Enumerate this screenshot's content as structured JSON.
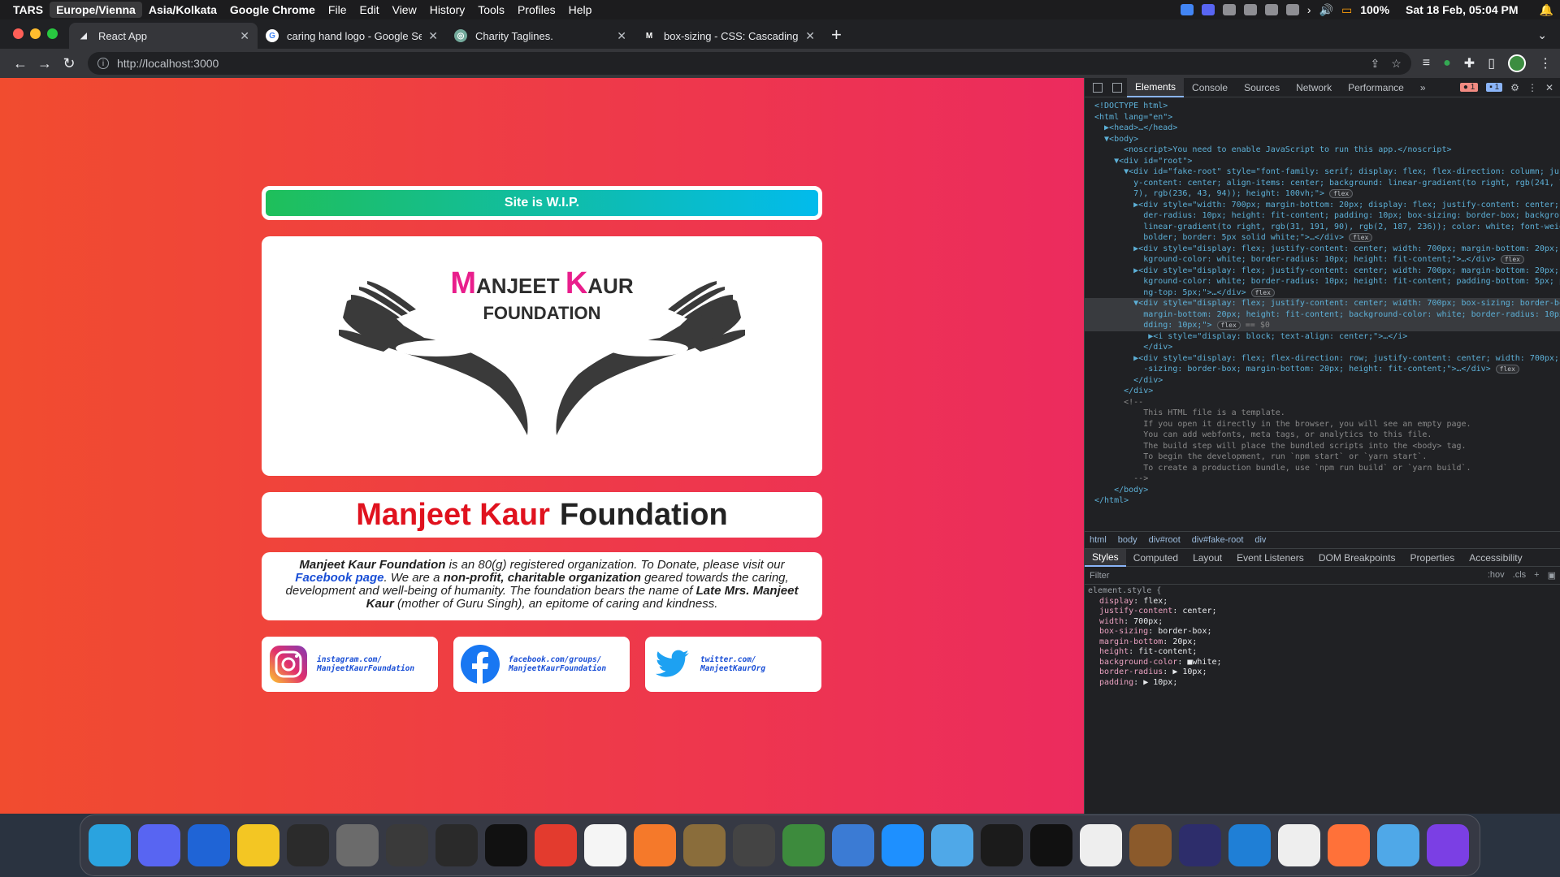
{
  "menubar": {
    "app_prefix": "TARS",
    "timezones": [
      "Europe/Vienna",
      "Asia/Kolkata"
    ],
    "app_name": "Google Chrome",
    "menus": [
      "File",
      "Edit",
      "View",
      "History",
      "Tools",
      "Profiles",
      "Help"
    ],
    "battery": "100%",
    "clock": "Sat 18 Feb, 05:04 PM"
  },
  "tabs": [
    {
      "title": "React App",
      "active": true
    },
    {
      "title": "caring hand logo - Google Sea"
    },
    {
      "title": "Charity Taglines."
    },
    {
      "title": "box-sizing - CSS: Cascading S"
    }
  ],
  "toolbar": {
    "url": "http://localhost:3000"
  },
  "page": {
    "wip": "Site is W.I.P.",
    "logo": {
      "line1_a": "M",
      "line1_b": "ANJEET ",
      "line1_c": "K",
      "line1_d": "AUR",
      "line2": "FOUNDATION"
    },
    "title_red": "Manjeet Kaur",
    "title_dark": "Foundation",
    "desc": {
      "p1": "Manjeet Kaur Foundation",
      "p2": " is an 80(g) registered organization. To Donate, please visit our ",
      "link": "Facebook page",
      "p3": ". We are a ",
      "p4": "non-profit, charitable organization",
      "p5": " geared towards the caring, development and well-being of humanity. The foundation bears the name of ",
      "p6": "Late Mrs. Manjeet Kaur",
      "p7": " (mother of Guru Singh), an epitome of caring and kindness."
    },
    "social": [
      {
        "l1": "instagram.com/",
        "l2": "ManjeetKaurFoundation"
      },
      {
        "l1": "facebook.com/groups/",
        "l2": "ManjeetKaurFoundation"
      },
      {
        "l1": "twitter.com/",
        "l2": "ManjeetKaurOrg"
      }
    ]
  },
  "devtools": {
    "tabs": [
      "Elements",
      "Console",
      "Sources",
      "Network",
      "Performance"
    ],
    "errors": "1",
    "messages": "1",
    "dom": [
      {
        "t": "<!DOCTYPE html>"
      },
      {
        "t": "<html lang=\"en\">"
      },
      {
        "t": "  ▶<head>…</head>"
      },
      {
        "t": "  ▼<body>"
      },
      {
        "t": "      <noscript>You need to enable JavaScript to run this app.</noscript>"
      },
      {
        "t": "    ▼<div id=\"root\">"
      },
      {
        "t": "      ▼<div id=\"fake-root\" style=\"font-family: serif; display: flex; flex-direction: column; justif"
      },
      {
        "t": "        y-content: center; align-items: center; background: linear-gradient(to right, rgb(241, 76, 4"
      },
      {
        "t": "        7), rgb(236, 43, 94)); height: 100vh;\">",
        "pill": "flex"
      },
      {
        "t": "        ▶<div style=\"width: 700px; margin-bottom: 20px; display: flex; justify-content: center; bor"
      },
      {
        "t": "          der-radius: 10px; height: fit-content; padding: 10px; box-sizing: border-box; background:"
      },
      {
        "t": "          linear-gradient(to right, rgb(31, 191, 90), rgb(2, 187, 236)); color: white; font-weight:"
      },
      {
        "t": "          bolder; border: 5px solid white;\">…</div>",
        "pill": "flex"
      },
      {
        "t": "        ▶<div style=\"display: flex; justify-content: center; width: 700px; margin-bottom: 20px; bac"
      },
      {
        "t": "          kground-color: white; border-radius: 10px; height: fit-content;\">…</div>",
        "pill": "flex"
      },
      {
        "t": "        ▶<div style=\"display: flex; justify-content: center; width: 700px; margin-bottom: 20px; bac"
      },
      {
        "t": "          kground-color: white; border-radius: 10px; height: fit-content; padding-bottom: 5px; paddi"
      },
      {
        "t": "          ng-top: 5px;\">…</div>",
        "pill": "flex"
      },
      {
        "t": "        ▼<div style=\"display: flex; justify-content: center; width: 700px; box-sizing: border-box;",
        "sel": true
      },
      {
        "t": "          margin-bottom: 20px; height: fit-content; background-color: white; border-radius: 10px; pa",
        "sel": true
      },
      {
        "t": "          dding: 10px;\">",
        "pill": "flex",
        "eq": "== $0",
        "sel": true
      },
      {
        "t": "           ▶<i style=\"display: block; text-align: center;\">…</i>"
      },
      {
        "t": "          </div>"
      },
      {
        "t": "        ▶<div style=\"display: flex; flex-direction: row; justify-content: center; width: 700px; box"
      },
      {
        "t": "          -sizing: border-box; margin-bottom: 20px; height: fit-content;\">…</div>",
        "pill": "flex"
      },
      {
        "t": "        </div>"
      },
      {
        "t": "      </div>"
      },
      {
        "t": "      <!--",
        "c": true
      },
      {
        "t": "          This HTML file is a template.",
        "c": true
      },
      {
        "t": "          If you open it directly in the browser, you will see an empty page.",
        "c": true
      },
      {
        "t": "",
        "c": true
      },
      {
        "t": "          You can add webfonts, meta tags, or analytics to this file.",
        "c": true
      },
      {
        "t": "          The build step will place the bundled scripts into the <body> tag.",
        "c": true
      },
      {
        "t": "",
        "c": true
      },
      {
        "t": "          To begin the development, run `npm start` or `yarn start`.",
        "c": true
      },
      {
        "t": "          To create a production bundle, use `npm run build` or `yarn build`.",
        "c": true
      },
      {
        "t": "        -->",
        "c": true
      },
      {
        "t": "    </body>"
      },
      {
        "t": "</html>"
      }
    ],
    "crumbs": [
      "html",
      "body",
      "div#root",
      "div#fake-root",
      "div"
    ],
    "style_tabs": [
      "Styles",
      "Computed",
      "Layout",
      "Event Listeners",
      "DOM Breakpoints",
      "Properties",
      "Accessibility"
    ],
    "filter_placeholder": "Filter",
    "filter_hov": ":hov",
    "filter_cls": ".cls",
    "element_style": "element.style {",
    "props": [
      {
        "n": "display",
        "v": "flex;"
      },
      {
        "n": "justify-content",
        "v": "center;"
      },
      {
        "n": "width",
        "v": "700px;"
      },
      {
        "n": "box-sizing",
        "v": "border-box;"
      },
      {
        "n": "margin-bottom",
        "v": "20px;"
      },
      {
        "n": "height",
        "v": "fit-content;"
      },
      {
        "n": "background-color",
        "v": "■white;"
      },
      {
        "n": "border-radius",
        "v": "▶ 10px;"
      },
      {
        "n": "padding",
        "v": "▶ 10px;"
      }
    ]
  },
  "dock": [
    "Telegram",
    "Discord",
    "Thunderbird",
    "Chrome Canary",
    "Raycast",
    "Font Book",
    "Sonic",
    "Voice Memos",
    "Clock",
    "Photo Booth",
    "Sketch",
    "Blender",
    "GIMP",
    "Screenshot",
    "Layers",
    "qBittorrent",
    "App Store",
    "Finder",
    "Activity Monitor",
    "Terminal",
    "TextEdit",
    "Acorn",
    "Proton",
    "VS Code",
    "Chrome",
    "Firefox",
    "Finder 2",
    "Firefox Dev"
  ]
}
